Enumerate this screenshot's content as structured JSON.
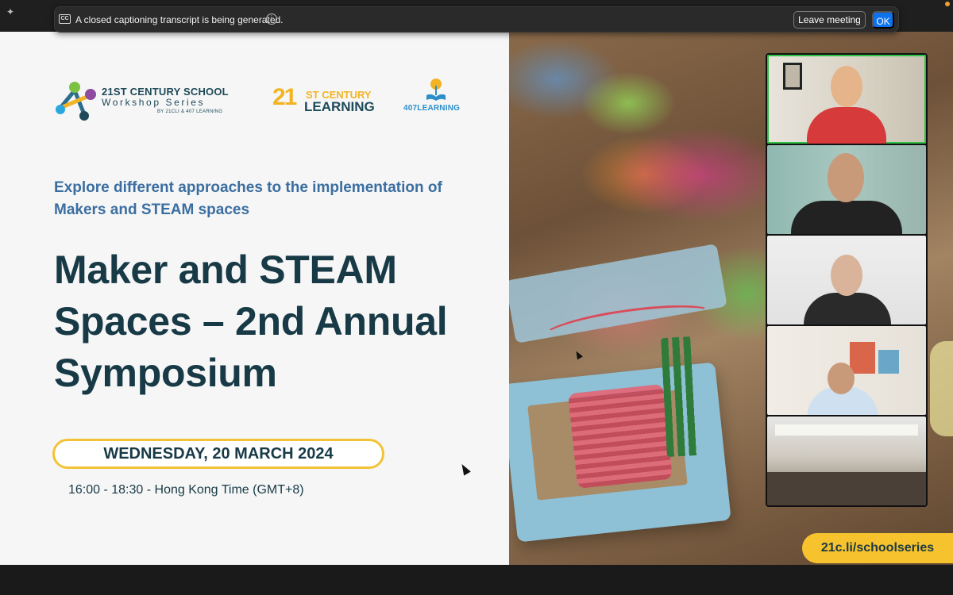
{
  "caption_notice": {
    "text": "A closed captioning transcript is being generated.",
    "cc_label": "CC",
    "info_label": "i",
    "leave_label": "Leave meeting",
    "ok_label": "OK"
  },
  "slide": {
    "logo_school": {
      "title": "21ST CENTURY SCHOOL",
      "subtitle": "Workshop Series",
      "byline": "BY 21CLI & 407 LEARNING"
    },
    "logo_21cl": {
      "number": "21",
      "top": "ST CENTURY",
      "bottom": "LEARNING"
    },
    "logo_407": {
      "text": "407LEARNING"
    },
    "subheadline": "Explore different approaches to the implementation of Makers and STEAM spaces",
    "headline": "Maker and STEAM Spaces – 2nd Annual Symposium",
    "date": "WEDNESDAY, 20 MARCH 2024",
    "time": "16:00 - 18:30 - Hong Kong Time (GMT+8)",
    "url": "21c.li/schoolseries"
  },
  "colors": {
    "accent_blue": "#0e72ed",
    "brand_yellow": "#f3c235",
    "navy": "#173a46",
    "speaker_highlight": "#31c046"
  }
}
